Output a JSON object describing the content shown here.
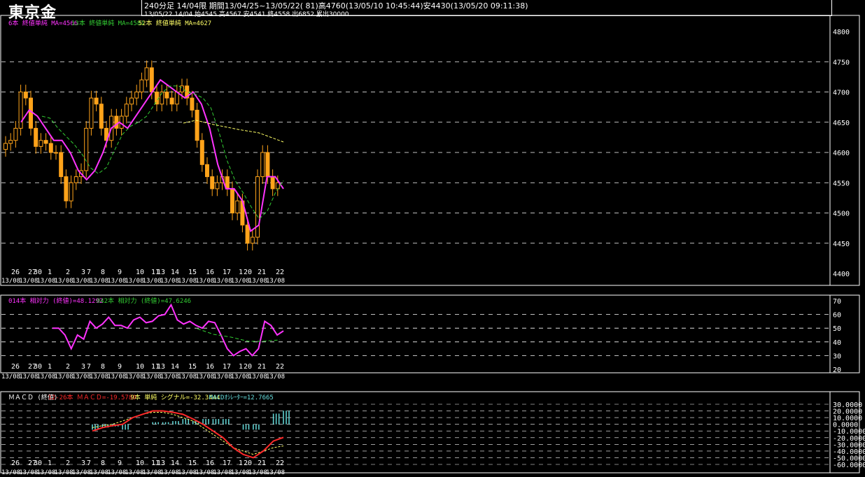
{
  "header": {
    "title": "東京金",
    "info_line1": "240分足 14/04限  期間13/04/25~13/05/22( 81)高4760(13/05/10 10:45:44)安4430(13/05/20 09:11:38)",
    "info_line2": "13/05/22 14/04 始4545 高4567 安4541 終4558 出6852 累出30000"
  },
  "colors": {
    "background": "#000000",
    "candle": "#ffa31a",
    "ma6": "#ff33ff",
    "ma13": "#33cc33",
    "ma52": "#ffff66",
    "grid": "#ffffff",
    "macd": "#ff2a2a",
    "signal": "#ffff66",
    "oscillator": "#66dddd"
  },
  "main_panel": {
    "legend": [
      {
        "text": "6本 終値単純 MA=4566",
        "color": "#ff33ff"
      },
      {
        "text": "13本 終値単純 MA=4581",
        "color": "#33cc33"
      },
      {
        "text": "52本 終値単純 MA=4627",
        "color": "#ffff66"
      }
    ],
    "y_ticks": [
      "4800",
      "4750",
      "4700",
      "4650",
      "4600",
      "4550",
      "4500",
      "4450",
      "4400"
    ]
  },
  "rsi_panel": {
    "legend": [
      {
        "text": "014本 相対力 (終値)=48.1292",
        "color": "#ff33ff"
      },
      {
        "text": "042本 相対力 (終値)=47.6246",
        "color": "#33cc33"
      }
    ],
    "y_ticks": [
      "70",
      "60",
      "50",
      "40",
      "30",
      "20"
    ]
  },
  "macd_panel": {
    "legend": [
      {
        "text": "ＭＡＣＤ (終値)",
        "color": "#ffffff"
      },
      {
        "text": "12-26本 ＭＡＣＤ=-19.5780",
        "color": "#ff2a2a"
      },
      {
        "text": "9本 単純 シグナル=-32.3444",
        "color": "#ffff66"
      },
      {
        "text": "MACDｵｼﾚｰﾀｰ=12.7665",
        "color": "#66dddd"
      }
    ],
    "y_ticks": [
      "30.0000",
      "20.0000",
      "10.0000",
      "0.0000",
      "-10.0000",
      "-20.0000",
      "-30.0000",
      "-40.0000",
      "-50.0000",
      "-60.0000"
    ]
  },
  "x_axis": {
    "day_labels": [
      "26",
      "27",
      "30",
      "1",
      "2",
      "3",
      "7",
      "8",
      "9",
      "10",
      "11",
      "13",
      "14",
      "15",
      "16",
      "17",
      "1",
      "20",
      "21",
      "22"
    ],
    "date_label": "13/08"
  },
  "chart_data": {
    "type": "line",
    "title": "東京金 240分足 14/04限",
    "candles_approx_close": [
      4615,
      4620,
      4640,
      4700,
      4690,
      4640,
      4610,
      4620,
      4615,
      4600,
      4600,
      4560,
      4520,
      4550,
      4560,
      4570,
      4640,
      4690,
      4680,
      4640,
      4620,
      4660,
      4640,
      4660,
      4680,
      4690,
      4700,
      4720,
      4740,
      4700,
      4680,
      4700,
      4690,
      4680,
      4700,
      4710,
      4690,
      4670,
      4620,
      4580,
      4560,
      4540,
      4550,
      4560,
      4540,
      4500,
      4520,
      4480,
      4450,
      4460,
      4560,
      4600,
      4560,
      4540,
      4550
    ],
    "ma6": [
      4650,
      4670,
      4660,
      4640,
      4620,
      4620,
      4600,
      4570,
      4555,
      4570,
      4600,
      4640,
      4650,
      4640,
      4660,
      4680,
      4700,
      4720,
      4710,
      4700,
      4690,
      4700,
      4680,
      4640,
      4580,
      4540,
      4540,
      4520,
      4470,
      4480,
      4560,
      4560,
      4540
    ],
    "rsi14": [
      50,
      50,
      45,
      35,
      45,
      42,
      55,
      50,
      53,
      58,
      52,
      52,
      50,
      56,
      58,
      54,
      55,
      59,
      60,
      67,
      56,
      53,
      55,
      52,
      50,
      55,
      54,
      45,
      35,
      30,
      33,
      35,
      30,
      35,
      55,
      52,
      45,
      48
    ],
    "macd": [
      -10,
      -5,
      -2,
      0,
      10,
      15,
      20,
      20,
      18,
      15,
      8,
      0,
      -10,
      -20,
      -35,
      -45,
      -50,
      -40,
      -25,
      -19.578
    ],
    "signal": [
      -5,
      -2,
      0,
      5,
      10,
      15,
      18,
      18,
      15,
      10,
      5,
      -5,
      -15,
      -25,
      -35,
      -40,
      -45,
      -40,
      -35,
      -32.3444
    ],
    "oscillator_last": 12.7665
  }
}
